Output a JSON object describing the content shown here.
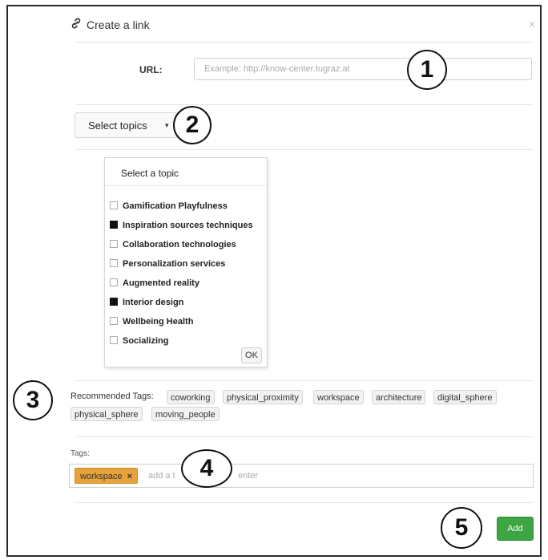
{
  "dialog": {
    "title": "Create a link",
    "close_icon": "×"
  },
  "url": {
    "label": "URL:",
    "placeholder": "Example: http://know-center.tugraz.at"
  },
  "topics": {
    "button_label": "Select topics",
    "caret": "▾",
    "dropdown_header": "Select a topic",
    "items": [
      {
        "label": "Gamification Playfulness",
        "checked": false
      },
      {
        "label": "Inspiration sources techniques",
        "checked": true
      },
      {
        "label": "Collaboration technologies",
        "checked": false
      },
      {
        "label": "Personalization services",
        "checked": false
      },
      {
        "label": "Augmented reality",
        "checked": false
      },
      {
        "label": "Interior design",
        "checked": true
      },
      {
        "label": "Wellbeing Health",
        "checked": false
      },
      {
        "label": "Socializing",
        "checked": false
      }
    ],
    "ok_label": "OK"
  },
  "recommended": {
    "label": "Recommended Tags:",
    "tags": [
      "coworking",
      "physical_proximity",
      "workspace",
      "architecture",
      "digital_sphere",
      "physical_sphere",
      "moving_people"
    ]
  },
  "tags": {
    "label": "Tags:",
    "chips": [
      {
        "label": "workspace",
        "remove": "×"
      }
    ],
    "placeholder_start": "add a t",
    "placeholder_end": "enter"
  },
  "actions": {
    "add_label": "Add"
  },
  "callouts": [
    "1",
    "2",
    "3",
    "4",
    "5"
  ],
  "colors": {
    "accent_green": "#3da542",
    "chip_orange": "#e8a23a"
  }
}
